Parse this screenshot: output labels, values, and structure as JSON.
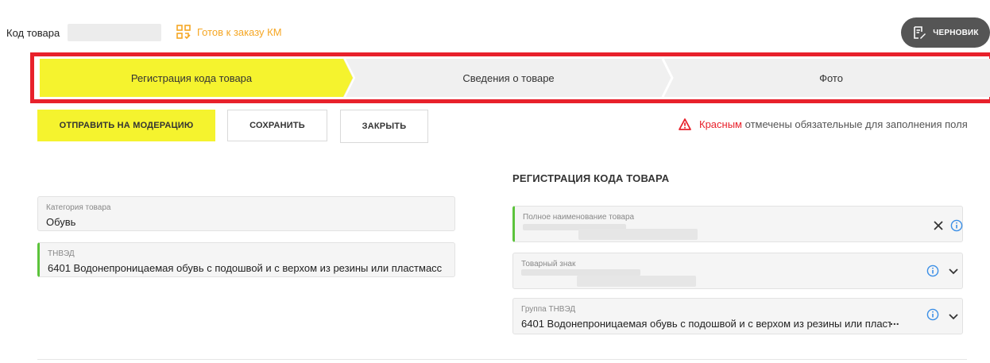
{
  "header": {
    "code_label": "Код товара",
    "km_status": "Готов к заказу КМ",
    "draft_label": "ЧЕРНОВИК"
  },
  "stepper": {
    "steps": [
      {
        "label": "Регистрация кода товара",
        "active": true
      },
      {
        "label": "Сведения о товаре",
        "active": false
      },
      {
        "label": "Фото",
        "active": false
      }
    ]
  },
  "actions": {
    "submit_label": "ОТПРАВИТЬ НА МОДЕРАЦИЮ",
    "save_label": "СОХРАНИТЬ",
    "close_label": "ЗАКРЫТЬ"
  },
  "required_note": {
    "red_word": "Красным",
    "rest": "отмечены обязательные для заполнения поля"
  },
  "left_fields": {
    "category": {
      "label": "Категория товара",
      "value": "Обувь"
    },
    "tnved": {
      "label": "ТНВЭД",
      "value": "6401 Водонепроницаемая обувь с подошвой и с верхом из резины или пластмасс"
    }
  },
  "right_section": {
    "title": "РЕГИСТРАЦИЯ КОДА ТОВАРА",
    "full_name": {
      "label": "Полное наименование товара"
    },
    "brand": {
      "label": "Товарный знак"
    },
    "tnved_group": {
      "label": "Группа ТНВЭД",
      "value": "6401 Водонепроницаемая обувь с подошвой и с верхом из резины или пласт",
      "ellipsis": "..."
    }
  },
  "colors": {
    "accent_yellow": "#f5f32e",
    "status_orange": "#f5a623",
    "highlight_red": "#e8212b",
    "required_green": "#5cc33b",
    "info_blue": "#3a8ee6"
  }
}
